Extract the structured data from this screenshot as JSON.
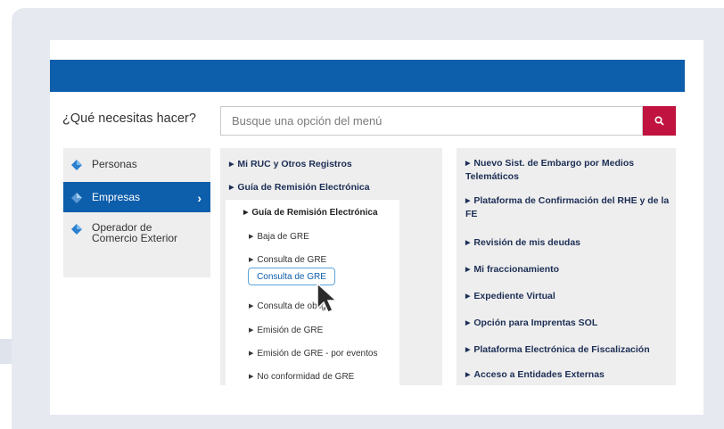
{
  "header": {
    "question": "¿Qué necesitas hacer?",
    "search_placeholder": "Busque una opción del menú",
    "search_icon": "search-icon"
  },
  "sidebar": {
    "items": [
      {
        "label": "Personas",
        "icon": "diamond-icon",
        "active": false
      },
      {
        "label": "Empresas",
        "icon": "diamond-icon",
        "active": true
      },
      {
        "label_line1": "Operador de",
        "label_line2": "Comercio Exterior",
        "icon": "diamond-icon",
        "active": false
      }
    ]
  },
  "menu_left": {
    "items": [
      "Mi RUC y Otros Registros",
      "Guía de Remisión Electrónica"
    ],
    "submenu_title": "Guía de Remisión Electrónica",
    "submenu_items": [
      "Baja de GRE",
      "Consulta de GRE",
      "Consulta de obliga",
      "Emisión de GRE",
      "Emisión de GRE - por eventos",
      "No conformidad de GRE"
    ],
    "highlighted_option": "Consulta de GRE"
  },
  "menu_right": {
    "items": [
      {
        "line1": "Nuevo Sist. de Embargo por Medios",
        "line2": "Telemáticos"
      },
      {
        "line1": "Plataforma de Confirmación del RHE y de la",
        "line2": "FE"
      },
      {
        "line1": "Revisión de mis deudas"
      },
      {
        "line1": "Mi fraccionamiento"
      },
      {
        "line1": "Expediente Virtual"
      },
      {
        "line1": "Opción para Imprentas SOL"
      },
      {
        "line1": "Plataforma Electrónica de Fiscalización"
      },
      {
        "line1": "Acceso a Entidades Externas"
      }
    ]
  },
  "colors": {
    "primary_blue": "#0d5eab",
    "search_button": "#c1133f",
    "link_text": "#1c2e55"
  }
}
